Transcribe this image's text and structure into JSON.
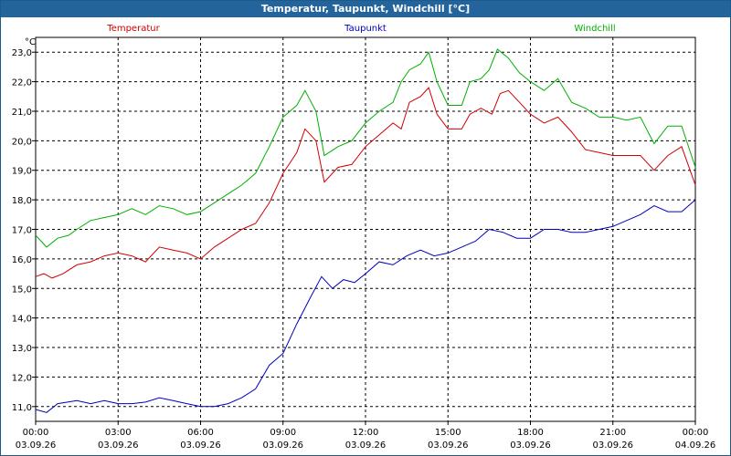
{
  "window": {
    "title": "Temperatur, Taupunkt, Windchill [°C]"
  },
  "chart_data": {
    "type": "line",
    "title": "Temperatur, Taupunkt, Windchill [°C]",
    "ylabel": "°C",
    "xlim_hours": [
      0,
      24
    ],
    "ylim": [
      10.5,
      23.5
    ],
    "yticks": [
      "11,0",
      "12,0",
      "13,0",
      "14,0",
      "15,0",
      "16,0",
      "17,0",
      "18,0",
      "19,0",
      "20,0",
      "21,0",
      "22,0",
      "23,0"
    ],
    "ytick_values": [
      11,
      12,
      13,
      14,
      15,
      16,
      17,
      18,
      19,
      20,
      21,
      22,
      23
    ],
    "xticks": [
      {
        "time": "00:00",
        "date": "03.09.26",
        "hour": 0
      },
      {
        "time": "03:00",
        "date": "03.09.26",
        "hour": 3
      },
      {
        "time": "06:00",
        "date": "03.09.26",
        "hour": 6
      },
      {
        "time": "09:00",
        "date": "03.09.26",
        "hour": 9
      },
      {
        "time": "12:00",
        "date": "03.09.26",
        "hour": 12
      },
      {
        "time": "15:00",
        "date": "03.09.26",
        "hour": 15
      },
      {
        "time": "18:00",
        "date": "03.09.26",
        "hour": 18
      },
      {
        "time": "21:00",
        "date": "03.09.26",
        "hour": 21
      },
      {
        "time": "00:00",
        "date": "04.09.26",
        "hour": 24
      }
    ],
    "grid": true,
    "series": [
      {
        "name": "Temperatur",
        "color": "#d00000",
        "points": [
          [
            0,
            15.4
          ],
          [
            0.3,
            15.5
          ],
          [
            0.6,
            15.35
          ],
          [
            1,
            15.5
          ],
          [
            1.5,
            15.8
          ],
          [
            2,
            15.9
          ],
          [
            2.5,
            16.1
          ],
          [
            3,
            16.2
          ],
          [
            3.5,
            16.1
          ],
          [
            4,
            15.9
          ],
          [
            4.5,
            16.4
          ],
          [
            5,
            16.3
          ],
          [
            5.5,
            16.2
          ],
          [
            6,
            16.0
          ],
          [
            6.5,
            16.4
          ],
          [
            7,
            16.7
          ],
          [
            7.5,
            17.0
          ],
          [
            8,
            17.2
          ],
          [
            8.5,
            17.9
          ],
          [
            9,
            18.9
          ],
          [
            9.5,
            19.6
          ],
          [
            9.8,
            20.4
          ],
          [
            10.2,
            20.0
          ],
          [
            10.5,
            18.6
          ],
          [
            11,
            19.1
          ],
          [
            11.5,
            19.2
          ],
          [
            12,
            19.8
          ],
          [
            12.5,
            20.2
          ],
          [
            13,
            20.6
          ],
          [
            13.3,
            20.4
          ],
          [
            13.6,
            21.3
          ],
          [
            14,
            21.5
          ],
          [
            14.3,
            21.8
          ],
          [
            14.6,
            20.9
          ],
          [
            15,
            20.4
          ],
          [
            15.5,
            20.4
          ],
          [
            15.8,
            20.9
          ],
          [
            16.2,
            21.1
          ],
          [
            16.6,
            20.9
          ],
          [
            16.9,
            21.6
          ],
          [
            17.2,
            21.7
          ],
          [
            17.6,
            21.3
          ],
          [
            18,
            20.9
          ],
          [
            18.5,
            20.6
          ],
          [
            19,
            20.8
          ],
          [
            19.5,
            20.3
          ],
          [
            20,
            19.7
          ],
          [
            20.5,
            19.6
          ],
          [
            21,
            19.5
          ],
          [
            21.5,
            19.5
          ],
          [
            22,
            19.5
          ],
          [
            22.5,
            19.0
          ],
          [
            23,
            19.5
          ],
          [
            23.5,
            19.8
          ],
          [
            24,
            18.5
          ]
        ]
      },
      {
        "name": "Taupunkt",
        "color": "#0000c0",
        "points": [
          [
            0,
            10.9
          ],
          [
            0.4,
            10.8
          ],
          [
            0.8,
            11.1
          ],
          [
            1.5,
            11.2
          ],
          [
            2,
            11.1
          ],
          [
            2.5,
            11.2
          ],
          [
            3,
            11.1
          ],
          [
            3.5,
            11.1
          ],
          [
            4,
            11.15
          ],
          [
            4.5,
            11.3
          ],
          [
            5,
            11.2
          ],
          [
            5.5,
            11.1
          ],
          [
            6,
            11.0
          ],
          [
            6.5,
            11.0
          ],
          [
            7,
            11.1
          ],
          [
            7.5,
            11.3
          ],
          [
            8,
            11.6
          ],
          [
            8.5,
            12.4
          ],
          [
            9,
            12.8
          ],
          [
            9.5,
            13.8
          ],
          [
            10,
            14.7
          ],
          [
            10.4,
            15.4
          ],
          [
            10.8,
            15.0
          ],
          [
            11.2,
            15.3
          ],
          [
            11.6,
            15.2
          ],
          [
            12,
            15.5
          ],
          [
            12.5,
            15.9
          ],
          [
            13,
            15.8
          ],
          [
            13.5,
            16.1
          ],
          [
            14,
            16.3
          ],
          [
            14.5,
            16.1
          ],
          [
            15,
            16.2
          ],
          [
            15.5,
            16.4
          ],
          [
            16,
            16.6
          ],
          [
            16.5,
            17.0
          ],
          [
            17,
            16.9
          ],
          [
            17.5,
            16.7
          ],
          [
            18,
            16.7
          ],
          [
            18.5,
            17.0
          ],
          [
            19,
            17.0
          ],
          [
            19.5,
            16.9
          ],
          [
            20,
            16.9
          ],
          [
            20.5,
            17.0
          ],
          [
            21,
            17.1
          ],
          [
            21.5,
            17.3
          ],
          [
            22,
            17.5
          ],
          [
            22.5,
            17.8
          ],
          [
            23,
            17.6
          ],
          [
            23.5,
            17.6
          ],
          [
            24,
            18.0
          ]
        ]
      },
      {
        "name": "Windchill",
        "color": "#00b000",
        "points": [
          [
            0,
            16.8
          ],
          [
            0.4,
            16.4
          ],
          [
            0.8,
            16.7
          ],
          [
            1.2,
            16.8
          ],
          [
            1.5,
            17.0
          ],
          [
            2,
            17.3
          ],
          [
            2.5,
            17.4
          ],
          [
            3,
            17.5
          ],
          [
            3.5,
            17.7
          ],
          [
            4,
            17.5
          ],
          [
            4.5,
            17.8
          ],
          [
            5,
            17.7
          ],
          [
            5.5,
            17.5
          ],
          [
            6,
            17.6
          ],
          [
            6.5,
            17.9
          ],
          [
            7,
            18.2
          ],
          [
            7.5,
            18.5
          ],
          [
            8,
            18.9
          ],
          [
            8.5,
            19.8
          ],
          [
            9,
            20.8
          ],
          [
            9.5,
            21.2
          ],
          [
            9.8,
            21.7
          ],
          [
            10.2,
            21.0
          ],
          [
            10.5,
            19.5
          ],
          [
            11,
            19.8
          ],
          [
            11.5,
            20.0
          ],
          [
            12,
            20.6
          ],
          [
            12.5,
            21.0
          ],
          [
            13,
            21.3
          ],
          [
            13.3,
            22.0
          ],
          [
            13.6,
            22.4
          ],
          [
            14,
            22.6
          ],
          [
            14.3,
            23.0
          ],
          [
            14.6,
            22.0
          ],
          [
            15,
            21.2
          ],
          [
            15.5,
            21.2
          ],
          [
            15.8,
            22.0
          ],
          [
            16.2,
            22.1
          ],
          [
            16.5,
            22.4
          ],
          [
            16.8,
            23.1
          ],
          [
            17.2,
            22.8
          ],
          [
            17.6,
            22.3
          ],
          [
            18,
            22.0
          ],
          [
            18.5,
            21.7
          ],
          [
            19,
            22.1
          ],
          [
            19.5,
            21.3
          ],
          [
            20,
            21.1
          ],
          [
            20.5,
            20.8
          ],
          [
            21,
            20.8
          ],
          [
            21.5,
            20.7
          ],
          [
            22,
            20.8
          ],
          [
            22.5,
            19.9
          ],
          [
            23,
            20.5
          ],
          [
            23.5,
            20.5
          ],
          [
            24,
            19.1
          ]
        ]
      }
    ]
  }
}
